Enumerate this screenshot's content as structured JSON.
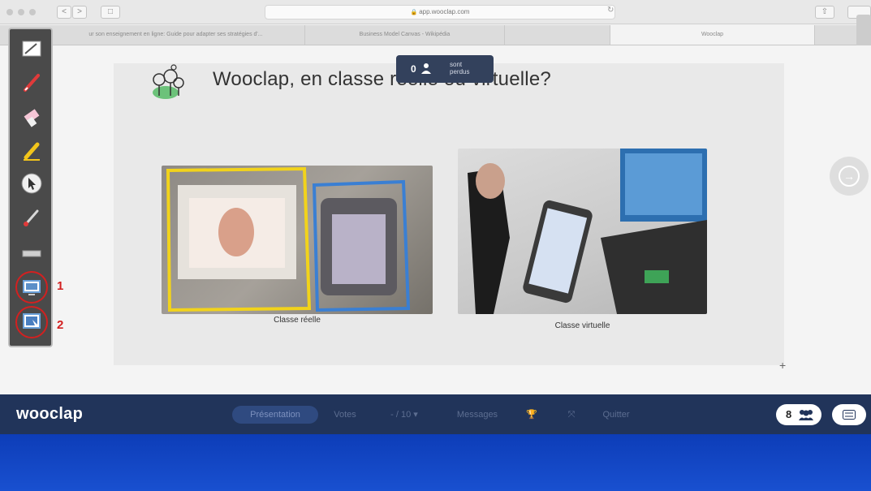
{
  "browser": {
    "url": "app.wooclap.com",
    "nav_back": "<",
    "nav_forward": ">",
    "sidebar_toggle": "□",
    "reload": "↻",
    "share": "⇧",
    "tabs": [
      {
        "label": "ur son enseignement en ligne: Guide pour adapter ses stratégies d'..."
      },
      {
        "label": "Business Model Canvas - Wikipédia"
      },
      {
        "label": ""
      },
      {
        "label": "Wooclap"
      }
    ]
  },
  "slide": {
    "title": "Wooclap, en classe réelle ou virtuelle?",
    "lost_count": "0",
    "lost_text_line1": "sont",
    "lost_text_line2": "perdus",
    "images": [
      {
        "caption": "Classe réelle"
      },
      {
        "caption": "Classe virtuelle"
      }
    ],
    "next_icon": "→",
    "plus": "+"
  },
  "annotations": {
    "one": "1",
    "two": "2"
  },
  "footer": {
    "brand": "wooclap",
    "buttons": {
      "presentation": "Présentation",
      "votes": "Votes",
      "pages": "- / 10 ▾",
      "messages": "Messages",
      "trophy": "🏆",
      "expand": "⤧",
      "quit": "Quitter"
    },
    "participants": "8"
  },
  "colors": {
    "footer_bg": "#21345a",
    "annotation_red": "#d32020",
    "bottom_band": "#1950d0"
  }
}
